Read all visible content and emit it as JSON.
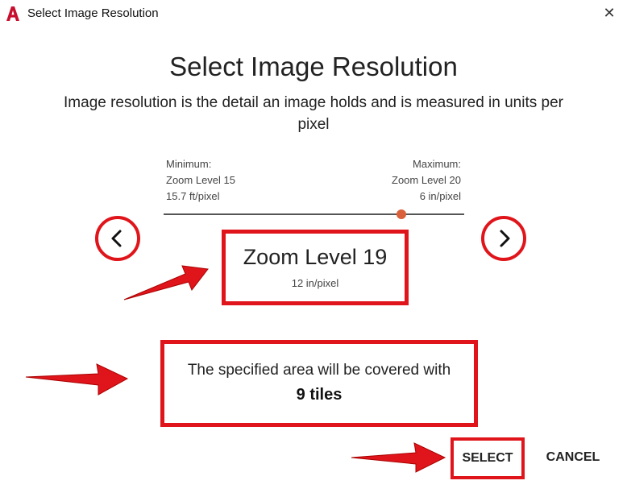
{
  "window": {
    "title": "Select Image Resolution",
    "close_symbol": "✕",
    "app_icon": "autocad-logo-icon"
  },
  "dialog": {
    "heading": "Select Image Resolution",
    "description": "Image resolution is the detail an image holds and is measured in units per pixel"
  },
  "slider": {
    "min_label": "Minimum:",
    "min_level": "Zoom Level 15",
    "min_res": "15.7 ft/pixel",
    "max_label": "Maximum:",
    "max_level": "Zoom Level 20",
    "max_res": "6 in/pixel",
    "min_value": 15,
    "max_value": 20,
    "current_value": 19,
    "prev_icon": "chevron-left-icon",
    "next_icon": "chevron-right-icon"
  },
  "selection": {
    "zoom_level": "Zoom Level 19",
    "resolution": "12 in/pixel"
  },
  "coverage": {
    "text": "The specified area will be covered with",
    "tiles": "9 tiles"
  },
  "actions": {
    "select_label": "SELECT",
    "cancel_label": "CANCEL"
  },
  "colors": {
    "highlight": "#e0151b",
    "slider_thumb": "#d9603b",
    "brand": "#c8102e"
  }
}
